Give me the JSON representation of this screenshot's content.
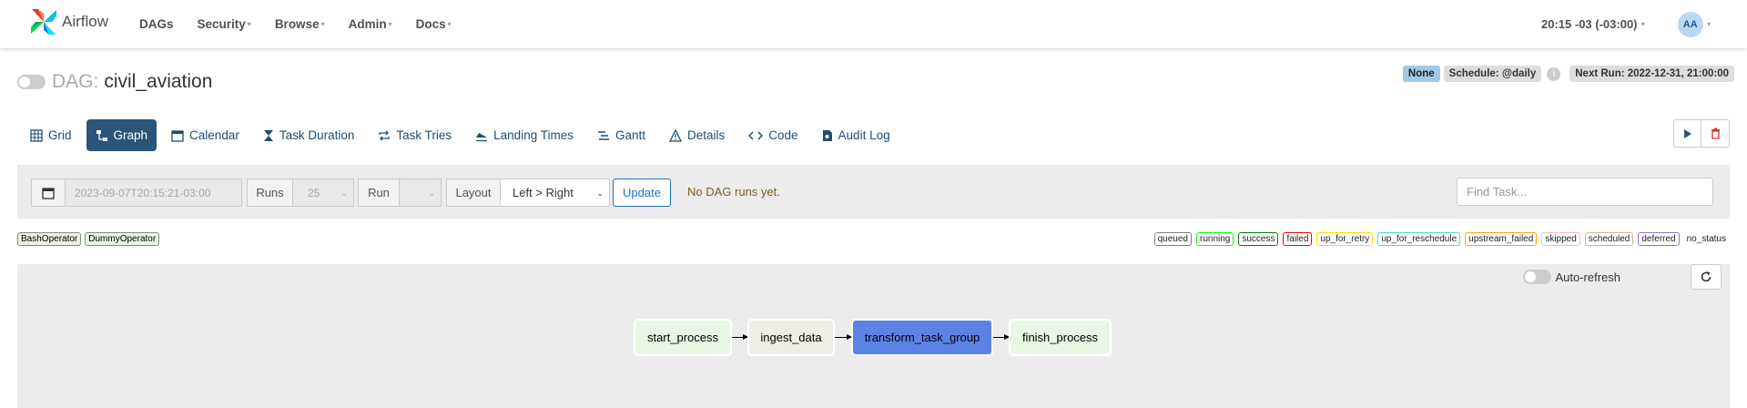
{
  "navbar": {
    "brand": "Airflow",
    "menu": [
      {
        "label": "DAGs",
        "dropdown": false
      },
      {
        "label": "Security",
        "dropdown": true
      },
      {
        "label": "Browse",
        "dropdown": true
      },
      {
        "label": "Admin",
        "dropdown": true
      },
      {
        "label": "Docs",
        "dropdown": true
      }
    ],
    "clock": "20:15 -03 (-03:00)",
    "avatar_initials": "AA"
  },
  "dag": {
    "label": "DAG:",
    "name": "civil_aviation",
    "badge_none": "None",
    "schedule": "Schedule: @daily",
    "next_run": "Next Run: 2022-12-31, 21:00:00"
  },
  "tabs": [
    {
      "label": "Grid",
      "icon": "grid-icon",
      "active": false
    },
    {
      "label": "Graph",
      "icon": "graph-icon",
      "active": true
    },
    {
      "label": "Calendar",
      "icon": "calendar-icon",
      "active": false
    },
    {
      "label": "Task Duration",
      "icon": "hourglass-icon",
      "active": false
    },
    {
      "label": "Task Tries",
      "icon": "retry-icon",
      "active": false
    },
    {
      "label": "Landing Times",
      "icon": "landing-icon",
      "active": false
    },
    {
      "label": "Gantt",
      "icon": "gantt-icon",
      "active": false
    },
    {
      "label": "Details",
      "icon": "warning-icon",
      "active": false
    },
    {
      "label": "Code",
      "icon": "code-icon",
      "active": false
    },
    {
      "label": "Audit Log",
      "icon": "audit-icon",
      "active": false
    }
  ],
  "filter": {
    "base_date": "2023-09-07T20:15:21-03:00",
    "runs_label": "Runs",
    "runs_value": "25",
    "run_label": "Run",
    "run_value": "",
    "layout_label": "Layout",
    "layout_value": "Left > Right",
    "update_label": "Update",
    "no_runs_text": "No DAG runs yet.",
    "find_task_placeholder": "Find Task..."
  },
  "operators": [
    {
      "label": "BashOperator",
      "color": "#f0ede4"
    },
    {
      "label": "DummyOperator",
      "color": "#e8f7e4"
    }
  ],
  "statuses": [
    {
      "label": "queued",
      "color": "#808080"
    },
    {
      "label": "running",
      "color": "#00ff00"
    },
    {
      "label": "success",
      "color": "#008000"
    },
    {
      "label": "failed",
      "color": "#ff0000"
    },
    {
      "label": "up_for_retry",
      "color": "#ffd700"
    },
    {
      "label": "up_for_reschedule",
      "color": "#40e0d0"
    },
    {
      "label": "upstream_failed",
      "color": "#ffa500"
    },
    {
      "label": "skipped",
      "color": "#ffb6c1"
    },
    {
      "label": "scheduled",
      "color": "#d2b48c"
    },
    {
      "label": "deferred",
      "color": "#9370db"
    },
    {
      "label": "no_status",
      "color": ""
    }
  ],
  "graph": {
    "auto_refresh_label": "Auto-refresh",
    "nodes": [
      {
        "label": "start_process",
        "color": "#e8f7e4"
      },
      {
        "label": "ingest_data",
        "color": "#f0ede4"
      },
      {
        "label": "transform_task_group",
        "color": "#5b83e6"
      },
      {
        "label": "finish_process",
        "color": "#e8f7e4"
      }
    ]
  }
}
